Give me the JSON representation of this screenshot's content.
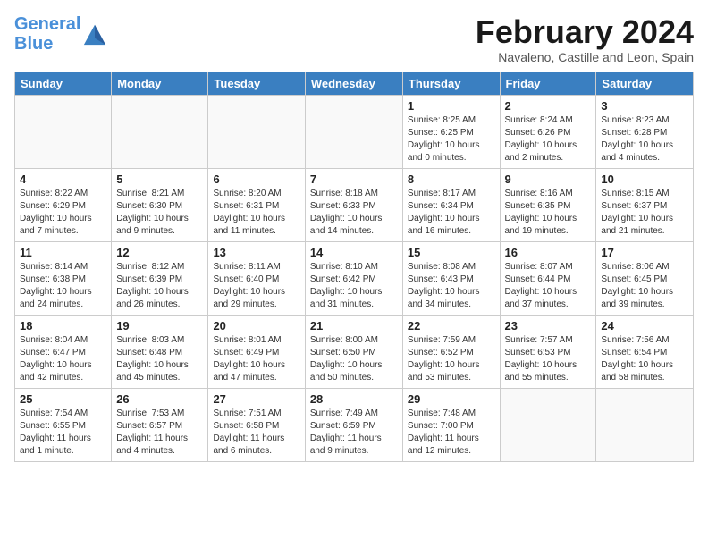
{
  "logo": {
    "line1": "General",
    "line2": "Blue"
  },
  "title": "February 2024",
  "subtitle": "Navaleno, Castille and Leon, Spain",
  "weekdays": [
    "Sunday",
    "Monday",
    "Tuesday",
    "Wednesday",
    "Thursday",
    "Friday",
    "Saturday"
  ],
  "weeks": [
    [
      {
        "day": "",
        "info": ""
      },
      {
        "day": "",
        "info": ""
      },
      {
        "day": "",
        "info": ""
      },
      {
        "day": "",
        "info": ""
      },
      {
        "day": "1",
        "info": "Sunrise: 8:25 AM\nSunset: 6:25 PM\nDaylight: 10 hours\nand 0 minutes."
      },
      {
        "day": "2",
        "info": "Sunrise: 8:24 AM\nSunset: 6:26 PM\nDaylight: 10 hours\nand 2 minutes."
      },
      {
        "day": "3",
        "info": "Sunrise: 8:23 AM\nSunset: 6:28 PM\nDaylight: 10 hours\nand 4 minutes."
      }
    ],
    [
      {
        "day": "4",
        "info": "Sunrise: 8:22 AM\nSunset: 6:29 PM\nDaylight: 10 hours\nand 7 minutes."
      },
      {
        "day": "5",
        "info": "Sunrise: 8:21 AM\nSunset: 6:30 PM\nDaylight: 10 hours\nand 9 minutes."
      },
      {
        "day": "6",
        "info": "Sunrise: 8:20 AM\nSunset: 6:31 PM\nDaylight: 10 hours\nand 11 minutes."
      },
      {
        "day": "7",
        "info": "Sunrise: 8:18 AM\nSunset: 6:33 PM\nDaylight: 10 hours\nand 14 minutes."
      },
      {
        "day": "8",
        "info": "Sunrise: 8:17 AM\nSunset: 6:34 PM\nDaylight: 10 hours\nand 16 minutes."
      },
      {
        "day": "9",
        "info": "Sunrise: 8:16 AM\nSunset: 6:35 PM\nDaylight: 10 hours\nand 19 minutes."
      },
      {
        "day": "10",
        "info": "Sunrise: 8:15 AM\nSunset: 6:37 PM\nDaylight: 10 hours\nand 21 minutes."
      }
    ],
    [
      {
        "day": "11",
        "info": "Sunrise: 8:14 AM\nSunset: 6:38 PM\nDaylight: 10 hours\nand 24 minutes."
      },
      {
        "day": "12",
        "info": "Sunrise: 8:12 AM\nSunset: 6:39 PM\nDaylight: 10 hours\nand 26 minutes."
      },
      {
        "day": "13",
        "info": "Sunrise: 8:11 AM\nSunset: 6:40 PM\nDaylight: 10 hours\nand 29 minutes."
      },
      {
        "day": "14",
        "info": "Sunrise: 8:10 AM\nSunset: 6:42 PM\nDaylight: 10 hours\nand 31 minutes."
      },
      {
        "day": "15",
        "info": "Sunrise: 8:08 AM\nSunset: 6:43 PM\nDaylight: 10 hours\nand 34 minutes."
      },
      {
        "day": "16",
        "info": "Sunrise: 8:07 AM\nSunset: 6:44 PM\nDaylight: 10 hours\nand 37 minutes."
      },
      {
        "day": "17",
        "info": "Sunrise: 8:06 AM\nSunset: 6:45 PM\nDaylight: 10 hours\nand 39 minutes."
      }
    ],
    [
      {
        "day": "18",
        "info": "Sunrise: 8:04 AM\nSunset: 6:47 PM\nDaylight: 10 hours\nand 42 minutes."
      },
      {
        "day": "19",
        "info": "Sunrise: 8:03 AM\nSunset: 6:48 PM\nDaylight: 10 hours\nand 45 minutes."
      },
      {
        "day": "20",
        "info": "Sunrise: 8:01 AM\nSunset: 6:49 PM\nDaylight: 10 hours\nand 47 minutes."
      },
      {
        "day": "21",
        "info": "Sunrise: 8:00 AM\nSunset: 6:50 PM\nDaylight: 10 hours\nand 50 minutes."
      },
      {
        "day": "22",
        "info": "Sunrise: 7:59 AM\nSunset: 6:52 PM\nDaylight: 10 hours\nand 53 minutes."
      },
      {
        "day": "23",
        "info": "Sunrise: 7:57 AM\nSunset: 6:53 PM\nDaylight: 10 hours\nand 55 minutes."
      },
      {
        "day": "24",
        "info": "Sunrise: 7:56 AM\nSunset: 6:54 PM\nDaylight: 10 hours\nand 58 minutes."
      }
    ],
    [
      {
        "day": "25",
        "info": "Sunrise: 7:54 AM\nSunset: 6:55 PM\nDaylight: 11 hours\nand 1 minute."
      },
      {
        "day": "26",
        "info": "Sunrise: 7:53 AM\nSunset: 6:57 PM\nDaylight: 11 hours\nand 4 minutes."
      },
      {
        "day": "27",
        "info": "Sunrise: 7:51 AM\nSunset: 6:58 PM\nDaylight: 11 hours\nand 6 minutes."
      },
      {
        "day": "28",
        "info": "Sunrise: 7:49 AM\nSunset: 6:59 PM\nDaylight: 11 hours\nand 9 minutes."
      },
      {
        "day": "29",
        "info": "Sunrise: 7:48 AM\nSunset: 7:00 PM\nDaylight: 11 hours\nand 12 minutes."
      },
      {
        "day": "",
        "info": ""
      },
      {
        "day": "",
        "info": ""
      }
    ]
  ]
}
